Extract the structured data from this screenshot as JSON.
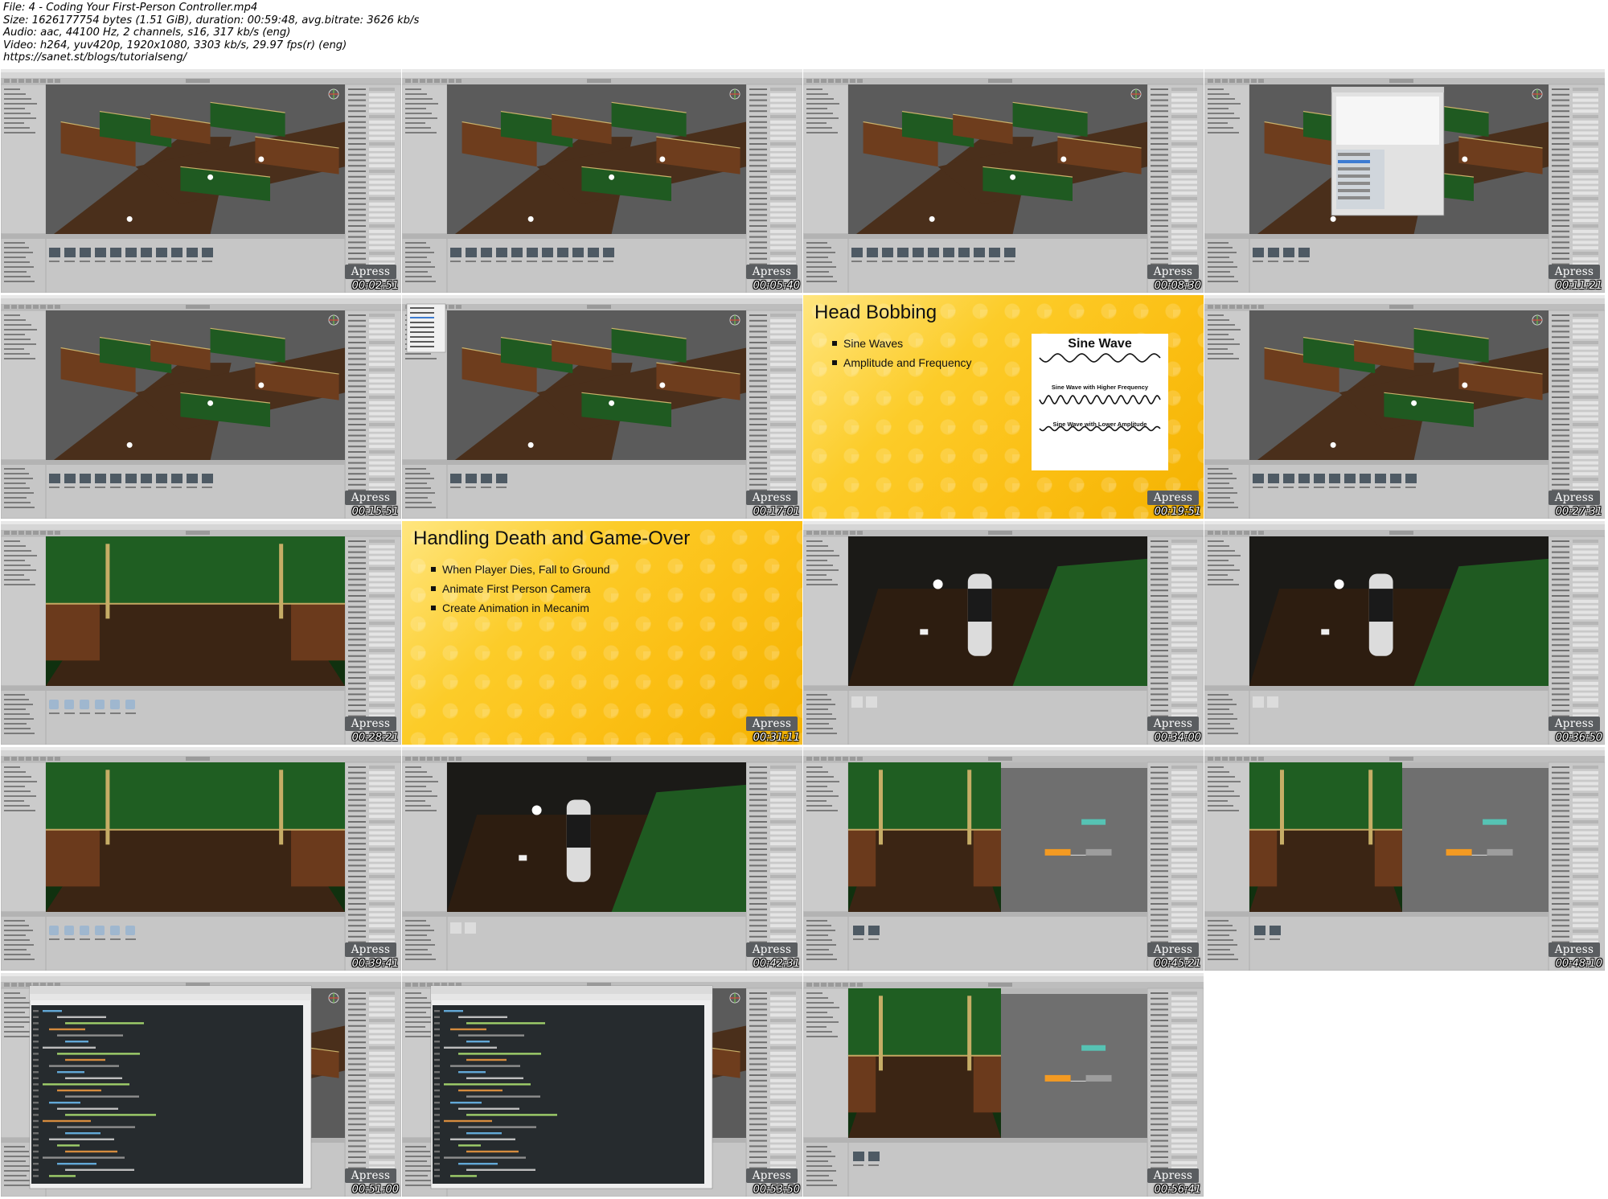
{
  "info": {
    "file": "File: 4 - Coding Your First-Person Controller.mp4",
    "size": "Size: 1626177754 bytes (1.51 GiB), duration: 00:59:48, avg.bitrate: 3626 kb/s",
    "audio": "Audio: aac, 44100 Hz, 2 channels, s16, 317 kb/s (eng)",
    "video": "Video: h264, yuv420p, 1920x1080, 3303 kb/s, 29.97 fps(r) (eng)",
    "url": "https://sanet.st/blogs/tutorialseng/"
  },
  "brand": "Apress",
  "colors": {
    "unity_panel": "#c2c2c2",
    "scene_floor": "#3e2a1a",
    "wall_green": "#1f5a21",
    "slide_yellow": "#fbbf14",
    "code_bg": "#262b2e"
  },
  "tiles": [
    {
      "time": "00:02:51",
      "kind": "unity-maze"
    },
    {
      "time": "00:05:40",
      "kind": "unity-maze"
    },
    {
      "time": "00:08:30",
      "kind": "unity-maze"
    },
    {
      "time": "00:11:21",
      "kind": "unity-dialog"
    },
    {
      "time": "00:15:51",
      "kind": "unity-maze"
    },
    {
      "time": "00:17:01",
      "kind": "unity-menu"
    },
    {
      "time": "00:19:51",
      "kind": "slide-sine",
      "title": "Head Bobbing",
      "bullets": [
        "Sine Waves",
        "Amplitude and Frequency"
      ],
      "sine_title": "Sine Wave",
      "sine_labels": [
        "Sine Wave with Higher Frequency",
        "Sine Wave with Lower Amplitude"
      ]
    },
    {
      "time": "00:27:31",
      "kind": "unity-maze"
    },
    {
      "time": "00:28:21",
      "kind": "unity-room"
    },
    {
      "time": "00:31:11",
      "kind": "slide",
      "title": "Handling Death and Game-Over",
      "bullets": [
        "When Player Dies, Fall to Ground",
        "Animate First Person Camera",
        "Create Animation in Mecanim"
      ]
    },
    {
      "time": "00:34:00",
      "kind": "unity-closeup"
    },
    {
      "time": "00:36:50",
      "kind": "unity-closeup"
    },
    {
      "time": "00:39:41",
      "kind": "unity-room"
    },
    {
      "time": "00:42:31",
      "kind": "unity-closeup"
    },
    {
      "time": "00:45:21",
      "kind": "unity-animator"
    },
    {
      "time": "00:48:10",
      "kind": "unity-animator"
    },
    {
      "time": "00:51:00",
      "kind": "unity-code"
    },
    {
      "time": "00:53:50",
      "kind": "unity-code"
    },
    {
      "time": "00:56:41",
      "kind": "unity-animator"
    }
  ]
}
